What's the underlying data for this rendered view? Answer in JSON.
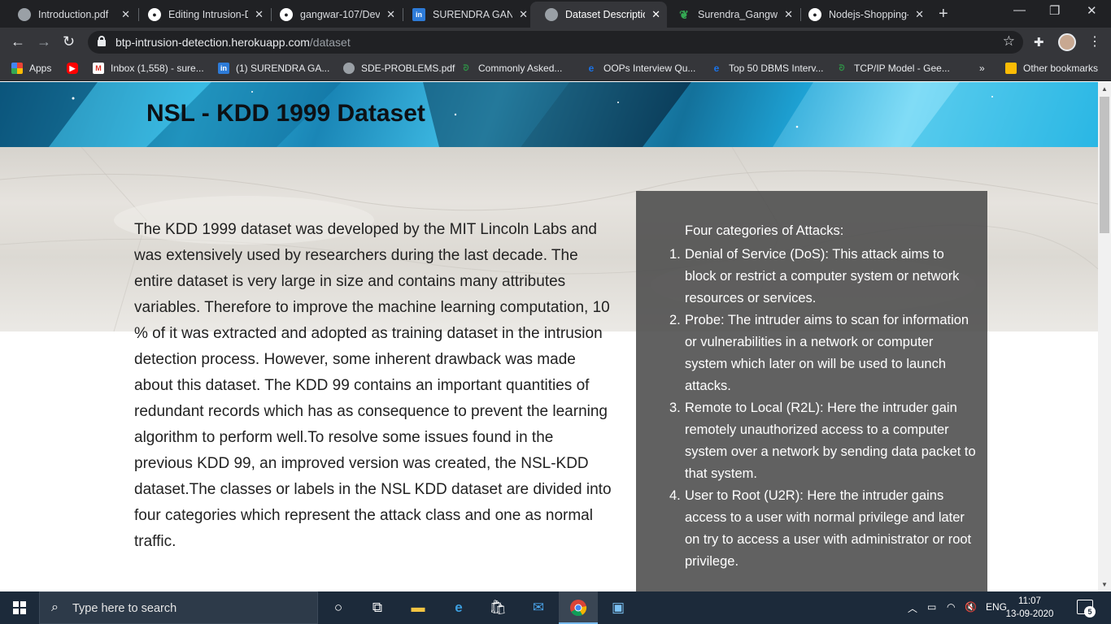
{
  "browser": {
    "tabs": [
      {
        "title": "Introduction.pdf",
        "icon": "globe-icon",
        "active": false
      },
      {
        "title": "Editing Intrusion-D",
        "icon": "github-icon",
        "active": false
      },
      {
        "title": "gangwar-107/Dev",
        "icon": "github-icon",
        "active": false
      },
      {
        "title": "SURENDRA GANG",
        "icon": "linkedin-icon",
        "active": false
      },
      {
        "title": "Dataset Descriptio",
        "icon": "globe-icon",
        "active": true
      },
      {
        "title": "Surendra_Gangwa",
        "icon": "leaf-icon",
        "active": false
      },
      {
        "title": "Nodejs-Shopping-",
        "icon": "github-icon",
        "active": false
      }
    ],
    "url": {
      "host": "btp-intrusion-detection.herokuapp.com",
      "path": "/dataset"
    },
    "bookmarks": [
      {
        "label": "Apps",
        "icon": "apps-grid-icon"
      },
      {
        "label": "",
        "icon": "youtube-icon"
      },
      {
        "label": "Inbox (1,558) - sure...",
        "icon": "gmail-icon"
      },
      {
        "label": "(1) SURENDRA GA...",
        "icon": "linkedin-icon"
      },
      {
        "label": "SDE-PROBLEMS.pdf",
        "icon": "globe-icon"
      },
      {
        "label": "Commonly Asked...",
        "icon": "gfg-icon"
      },
      {
        "label": "OOPs Interview Qu...",
        "icon": "edureka-icon"
      },
      {
        "label": "Top 50 DBMS Interv...",
        "icon": "edureka-icon"
      },
      {
        "label": "TCP/IP Model - Gee...",
        "icon": "gfg-icon"
      }
    ],
    "bookmarks_overflow": "»",
    "other_bookmarks": "Other bookmarks"
  },
  "page": {
    "title": "NSL - KDD 1999 Dataset",
    "intro": "The KDD 1999 dataset was developed by the MIT Lincoln Labs and was extensively used by researchers during the last decade. The entire dataset is very large in size and contains many attributes variables. Therefore to improve the machine learning computation, 10 % of it was extracted and adopted as training dataset in the intrusion detection process. However, some inherent drawback was made about this dataset. The KDD 99 contains an important quantities of redundant records which has as consequence to prevent the learning algorithm to perform well.To resolve some issues found in the previous KDD 99, an improved version was created, the NSL-KDD dataset.The classes or labels in the NSL KDD dataset are divided into four categories which represent the attack class and one as normal traffic.",
    "attacks": {
      "heading": "Four categories of Attacks:",
      "items": [
        {
          "num": "1.",
          "text": "Denial of Service (DoS): This attack aims to block or restrict a computer system or network resources or services."
        },
        {
          "num": "2.",
          "text": "Probe: The intruder aims to scan for information or vulnerabilities in a network or computer system which later on will be used to launch attacks."
        },
        {
          "num": "3.",
          "text": "Remote to Local (R2L): Here the intruder gain remotely unauthorized access to a computer system over a network by sending data packet to that system."
        },
        {
          "num": "4.",
          "text": "User to Root (U2R): Here the intruder gains access to a user with normal privilege and later on try to access a user with administrator or root privilege."
        }
      ]
    }
  },
  "taskbar": {
    "search_placeholder": "Type here to search",
    "language": "ENG",
    "time": "11:07",
    "date": "13-09-2020",
    "notification_count": "5"
  }
}
